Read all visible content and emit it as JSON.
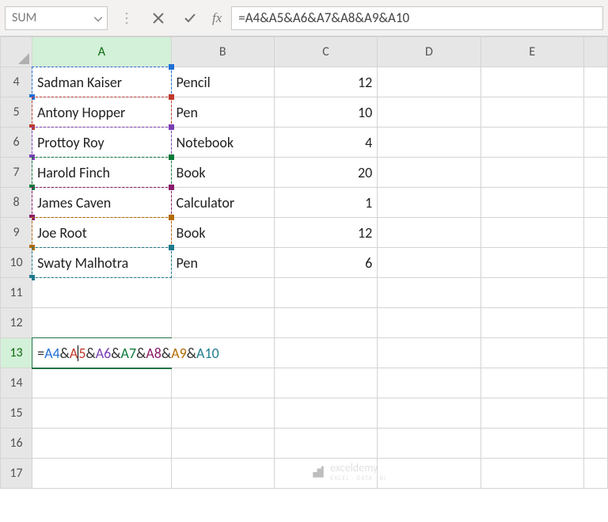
{
  "nameBox": {
    "value": "SUM"
  },
  "formulaBar": {
    "cancel_icon": "cancel-icon",
    "enter_icon": "enter-icon",
    "fx_label": "fx",
    "formula_text": "=A4&A5&A6&A7&A8&A9&A10"
  },
  "columns": [
    "A",
    "B",
    "C",
    "D",
    "E"
  ],
  "rowHeaders": [
    "4",
    "5",
    "6",
    "7",
    "8",
    "9",
    "10",
    "11",
    "12",
    "13",
    "14",
    "15",
    "16",
    "17"
  ],
  "activeRow": "13",
  "activeCol": "A",
  "data": {
    "r4": {
      "a": "Sadman Kaiser",
      "b": "Pencil",
      "c": "12"
    },
    "r5": {
      "a": "Antony Hopper",
      "b": "Pen",
      "c": "10"
    },
    "r6": {
      "a": "Prottoy Roy",
      "b": "Notebook",
      "c": "4"
    },
    "r7": {
      "a": "Harold Finch",
      "b": "Book",
      "c": "20"
    },
    "r8": {
      "a": "James Caven",
      "b": "Calculator",
      "c": "1"
    },
    "r9": {
      "a": "Joe Root",
      "b": "Book",
      "c": "12"
    },
    "r10": {
      "a": "Swaty Malhotra",
      "b": "Pen",
      "c": "6"
    }
  },
  "refColors": {
    "A4": "#1f6fd6",
    "A5": "#c0392b",
    "A6": "#7b3fb5",
    "A7": "#0a7a3b",
    "A8": "#8a1a6a",
    "A9": "#b36b00",
    "A10": "#1e7a8c"
  },
  "formulaTokens": {
    "eq": "=",
    "amp": "&",
    "refs": [
      "A4",
      "A5",
      "A6",
      "A7",
      "A8",
      "A9",
      "A10"
    ]
  },
  "watermark": {
    "brand": "exceldemy",
    "tag": "EXCEL · DATA · BI"
  }
}
